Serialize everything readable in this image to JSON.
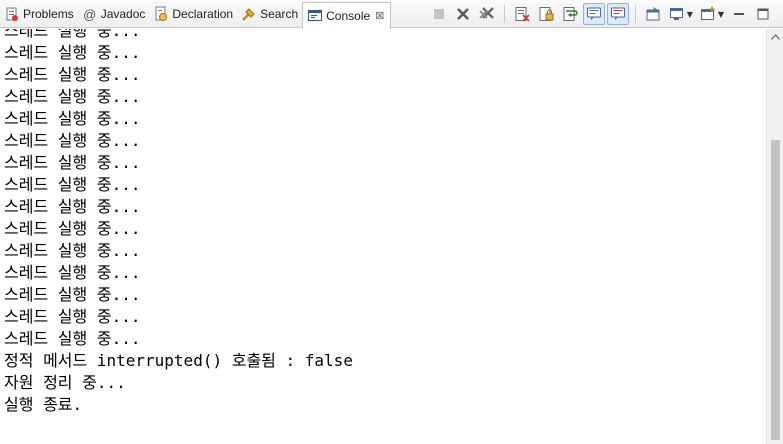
{
  "tabs": [
    {
      "label": "Problems",
      "icon": "problems-icon"
    },
    {
      "label": "Javadoc",
      "icon": "javadoc-icon"
    },
    {
      "label": "Declaration",
      "icon": "declaration-icon"
    },
    {
      "label": "Search",
      "icon": "search-icon"
    },
    {
      "label": "Console",
      "icon": "console-icon",
      "active": true,
      "close": "⊠"
    }
  ],
  "toolbar": {
    "icons": [
      "terminate-icon",
      "remove-launch-icon",
      "remove-all-terminated-icon",
      "clear-console-icon",
      "scroll-lock-icon",
      "word-wrap-icon",
      "show-on-stdout-icon",
      "show-on-stderr-icon",
      "pin-console-icon",
      "display-selected-console-icon",
      "open-console-icon"
    ]
  },
  "console": {
    "lines": [
      "스레드 실행 중...",
      "스레드 실행 중...",
      "스레드 실행 중...",
      "스레드 실행 중...",
      "스레드 실행 중...",
      "스레드 실행 중...",
      "스레드 실행 중...",
      "스레드 실행 중...",
      "스레드 실행 중...",
      "스레드 실행 중...",
      "스레드 실행 중...",
      "스레드 실행 중...",
      "스레드 실행 중...",
      "스레드 실행 중...",
      "스레드 실행 중...",
      "정적 메서드 interrupted() 호출됨 : false",
      "자원 정리 중...",
      "실행 종료."
    ]
  },
  "colors": {
    "console_text": "#000000",
    "background": "#ffffff",
    "tabbar": "#eeeeee"
  }
}
